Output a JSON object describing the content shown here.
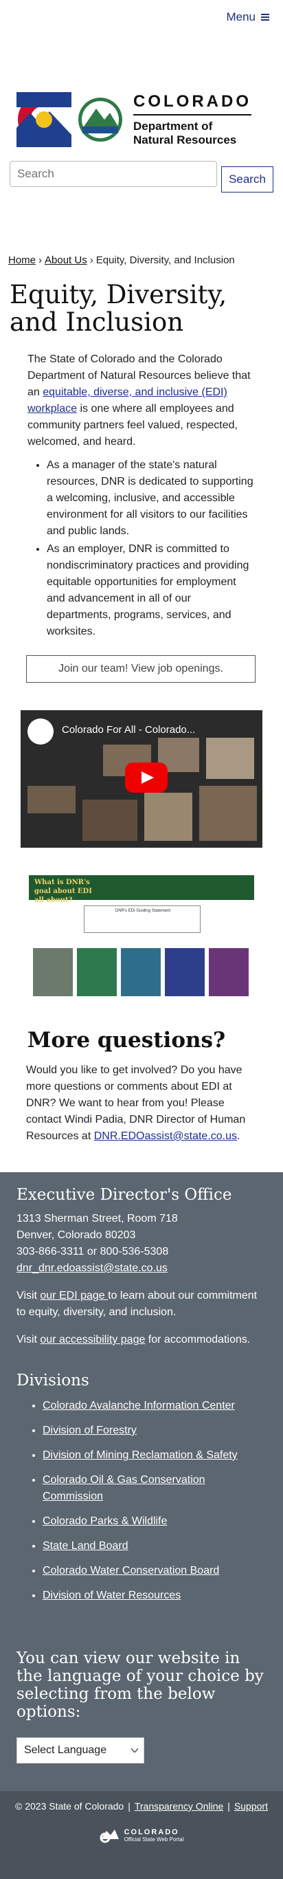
{
  "header": {
    "menu_label": "Menu"
  },
  "logo": {
    "state": "COLORADO",
    "dept_line1": "Department of",
    "dept_line2": "Natural Resources",
    "dnr_mark": "DNR"
  },
  "search": {
    "placeholder": "Search",
    "button": "Search"
  },
  "breadcrumb": {
    "home": "Home",
    "about": "About Us",
    "current": "Equity, Diversity, and Inclusion",
    "separator": "›"
  },
  "page": {
    "title": "Equity, Diversity, and Inclusion",
    "intro_before": "The State of Colorado and the Colorado Department of Natural Resources believe that an ",
    "intro_link": "equitable, diverse, and inclusive (EDI) workplace",
    "intro_after": " is one where all employees and community partners feel valued, respected, welcomed, and heard.",
    "bullets": [
      "As a manager of the state's natural resources, DNR is dedicated to supporting a welcoming, inclusive, and accessible environment for all visitors to our facilities and public lands.",
      "As an employer, DNR is committed to nondiscriminatory practices and providing equitable opportunities for employment and advancement in all of our departments, programs, services, and worksites."
    ],
    "job_button": "Join our team! View job openings.",
    "video_title": "Colorado For All - Colorado...",
    "infographic_title": "What is DNR's goal about EDI all about?",
    "infographic_box": "DNR's EDI Guiding Statement"
  },
  "more": {
    "heading": "More questions?",
    "text": "Would you like to get involved? Do you have more questions or comments about EDI at DNR? We want to hear from you! Please contact Windi Padia, DNR Director of Human Resources at ",
    "email": "DNR.EDOassist@state.co.us",
    "end": "."
  },
  "footer": {
    "heading": "Executive Director's Office",
    "address1": "1313 Sherman Street, Room 718",
    "address2": "Denver, Colorado 80203",
    "phones": "303-866-3311 or 800-536-5308",
    "email": "dnr_dnr.edoassist@state.co.us",
    "edi_before": "Visit ",
    "edi_link": "our EDI page ",
    "edi_after": "to learn about our commitment to equity, diversity, and inclusion.",
    "acc_before": "Visit ",
    "acc_link": "our accessibility page",
    "acc_after": " for accommodations.",
    "divisions_heading": "Divisions",
    "divisions": [
      "Colorado Avalanche Information Center",
      "Division of Forestry",
      "Division of Mining Reclamation & Safety",
      "Colorado Oil & Gas Conservation Commission",
      "Colorado Parks & Wildlife",
      "State Land Board",
      "Colorado Water Conservation Board",
      "Division of Water Resources"
    ],
    "language_heading": "You can view our website in the language of your choice by selecting from the below options:",
    "language_select": "Select Language"
  },
  "bottom": {
    "copyright": "© 2023 State of Colorado",
    "transparency": "Transparency Online",
    "support": "Support",
    "portal_name": "COLORADO",
    "portal_sub": "Official State Web Portal"
  },
  "colors": {
    "brand_blue": "#1d2f8a",
    "footer_gray": "#5b6670",
    "bottom_gray": "#4a535b"
  }
}
